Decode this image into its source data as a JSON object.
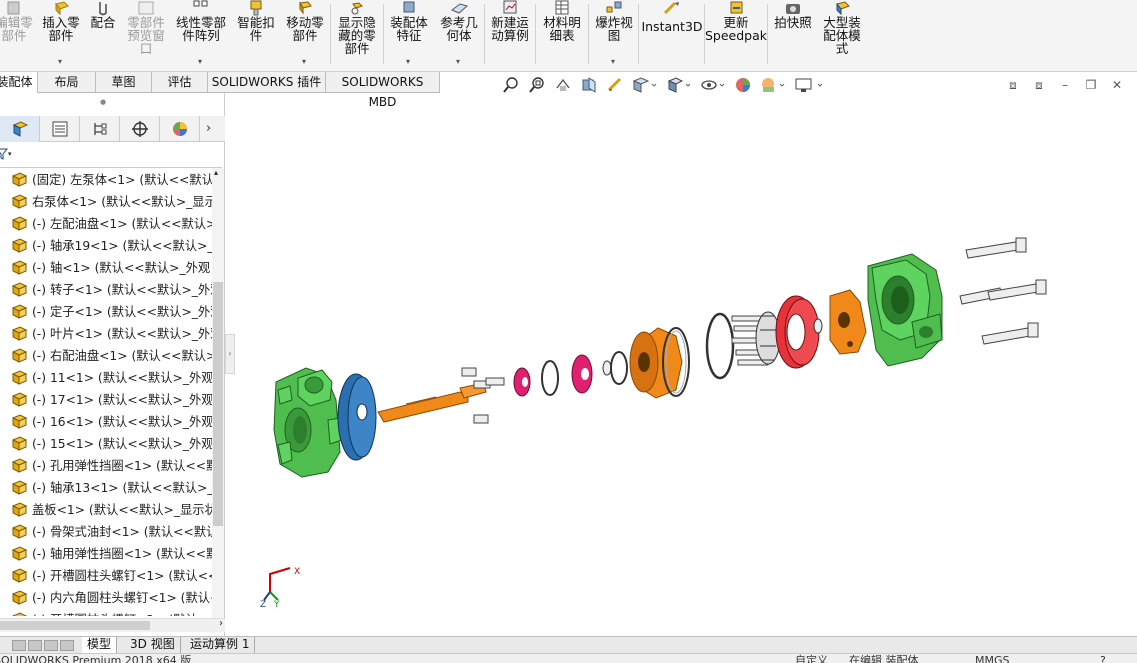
{
  "ribbon": {
    "buttons": [
      {
        "label": "编辑零\n部件",
        "dim": true
      },
      {
        "label": "插入零\n部件",
        "dim": false
      },
      {
        "label": "配合",
        "dim": false
      },
      {
        "label": "零部件\n预览窗\n口",
        "dim": true
      },
      {
        "label": "线性零部\n件阵列",
        "dim": false
      },
      {
        "label": "智能扣\n件",
        "dim": false
      },
      {
        "label": "移动零\n部件",
        "dim": false
      },
      {
        "label": "显示隐\n藏的零\n部件",
        "dim": false
      },
      {
        "label": "装配体\n特征",
        "dim": false
      },
      {
        "label": "参考几\n何体",
        "dim": false
      },
      {
        "label": "新建运\n动算例",
        "dim": false
      },
      {
        "label": "材料明\n细表",
        "dim": false
      },
      {
        "label": "爆炸视\n图",
        "dim": false
      },
      {
        "label": "Instant3D",
        "dim": false
      },
      {
        "label": "更新\nSpeedpak",
        "dim": false
      },
      {
        "label": "拍快照",
        "dim": false
      },
      {
        "label": "大型装\n配体模\n式",
        "dim": false
      }
    ]
  },
  "command_tabs": [
    "装配体",
    "布局",
    "草图",
    "评估",
    "SOLIDWORKS 插件",
    "SOLIDWORKS MBD"
  ],
  "active_command_tab": "装配体",
  "view_toolbar": {
    "icons": [
      "zoom-to-fit-icon",
      "zoom-to-area-icon",
      "previous-view-icon",
      "section-view-icon",
      "dynamic-annotation-icon",
      "view-orientation-icon",
      "display-style-icon",
      "hide-show-items-icon",
      "edit-appearance-icon",
      "apply-scene-icon",
      "view-settings-icon"
    ]
  },
  "feature_tree": {
    "items": [
      "(固定) 左泵体<1> (默认<<默认>",
      "右泵体<1> (默认<<默认>_显示状",
      "(-) 左配油盘<1> (默认<<默认>_",
      "(-) 轴承19<1> (默认<<默认>_外",
      "(-) 轴<1> (默认<<默认>_外观 显",
      "(-) 转子<1> (默认<<默认>_外观",
      "(-) 定子<1> (默认<<默认>_外观",
      "(-) 叶片<1> (默认<<默认>_外观",
      "(-) 右配油盘<1> (默认<<默认>_",
      "(-) 11<1> (默认<<默认>_外观 显",
      "(-) 17<1> (默认<<默认>_外观 显",
      "(-) 16<1> (默认<<默认>_外观 显",
      "(-) 15<1> (默认<<默认>_外观 显",
      "(-) 孔用弹性挡圈<1> (默认<<默",
      "(-) 轴承13<1> (默认<<默认>_外",
      "盖板<1> (默认<<默认>_显示状态",
      "(-) 骨架式油封<1> (默认<<默认",
      "(-) 轴用弹性挡圈<1> (默认<<默",
      "(-) 开槽圆柱头螺钉<1> (默认<<",
      "(-) 内六角圆柱头螺钉<1> (默认<",
      "(-) 开槽圆柱头螺钉<2> (默认<"
    ]
  },
  "bottom_tabs": [
    "模型",
    "3D 视图",
    "运动算例 1"
  ],
  "active_bottom_tab": "模型",
  "status": {
    "app": "SOLIDWORKS Premium 2018 x64 版",
    "custom": "自定义",
    "editing": "在编辑 装配体",
    "units": "MMGS"
  },
  "triad": {
    "x": "X",
    "y": "Y",
    "z": "Z"
  },
  "colors": {
    "green_part": "#4fbe4f",
    "orange_part": "#f0891a",
    "blue_part": "#2b6fb0",
    "red_part": "#e8323a",
    "magenta_part": "#e0206f"
  }
}
